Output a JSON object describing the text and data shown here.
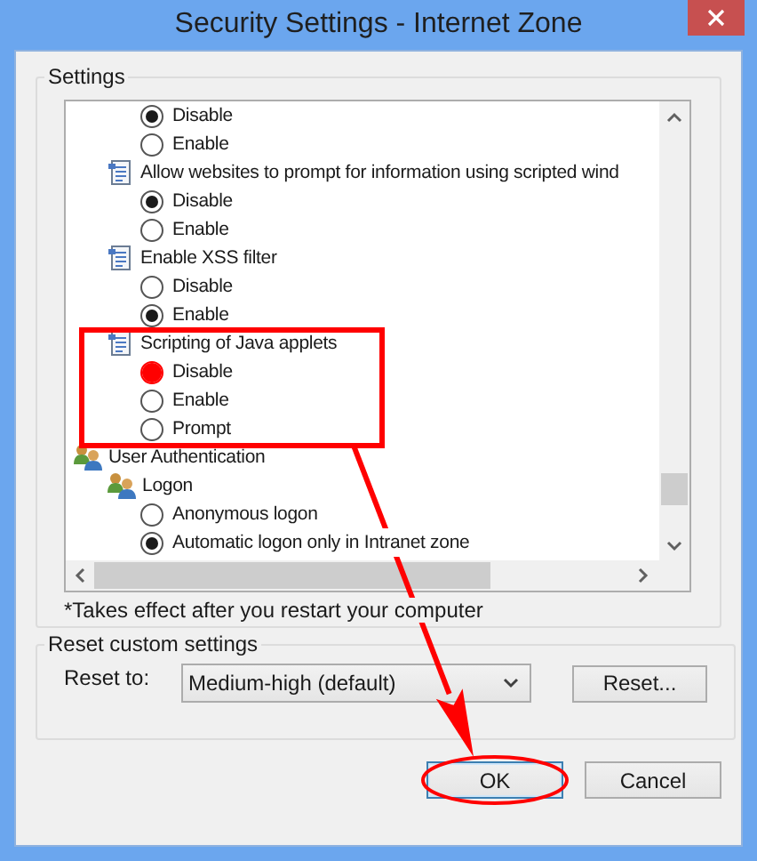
{
  "window": {
    "title": "Security Settings - Internet Zone"
  },
  "settings": {
    "title": "Settings",
    "items": [
      {
        "kind": "continuation",
        "children": [
          {
            "kind": "continuation",
            "children": [
              {
                "kind": "option",
                "label": "Disable",
                "selected": true
              },
              {
                "kind": "option",
                "label": "Enable",
                "selected": false
              }
            ]
          },
          {
            "kind": "setting",
            "label": "Allow websites to prompt for information using scripted wind",
            "children": [
              {
                "kind": "option",
                "label": "Disable",
                "selected": true
              },
              {
                "kind": "option",
                "label": "Enable",
                "selected": false
              }
            ]
          },
          {
            "kind": "setting",
            "label": "Enable XSS filter",
            "children": [
              {
                "kind": "option",
                "label": "Disable",
                "selected": false
              },
              {
                "kind": "option",
                "label": "Enable",
                "selected": true
              }
            ]
          },
          {
            "kind": "setting",
            "label": "Scripting of Java applets",
            "highlighted": true,
            "children": [
              {
                "kind": "option",
                "label": "Disable",
                "selected": true
              },
              {
                "kind": "option",
                "label": "Enable",
                "selected": false
              },
              {
                "kind": "option",
                "label": "Prompt",
                "selected": false
              }
            ]
          }
        ]
      },
      {
        "kind": "category",
        "label": "User Authentication",
        "children": [
          {
            "kind": "logon",
            "label": "Logon",
            "children": [
              {
                "kind": "option",
                "label": "Anonymous logon",
                "selected": false
              },
              {
                "kind": "option",
                "label": "Automatic logon only in Intranet zone",
                "selected": true
              }
            ]
          }
        ]
      }
    ],
    "note": "*Takes effect after you restart your computer"
  },
  "reset": {
    "title": "Reset custom settings",
    "label": "Reset to:",
    "dropdown": {
      "value": "Medium-high (default)"
    },
    "button": "Reset..."
  },
  "buttons": [
    {
      "label": "OK",
      "focused": true,
      "highlighted": true
    },
    {
      "label": "Cancel",
      "focused": false
    }
  ]
}
